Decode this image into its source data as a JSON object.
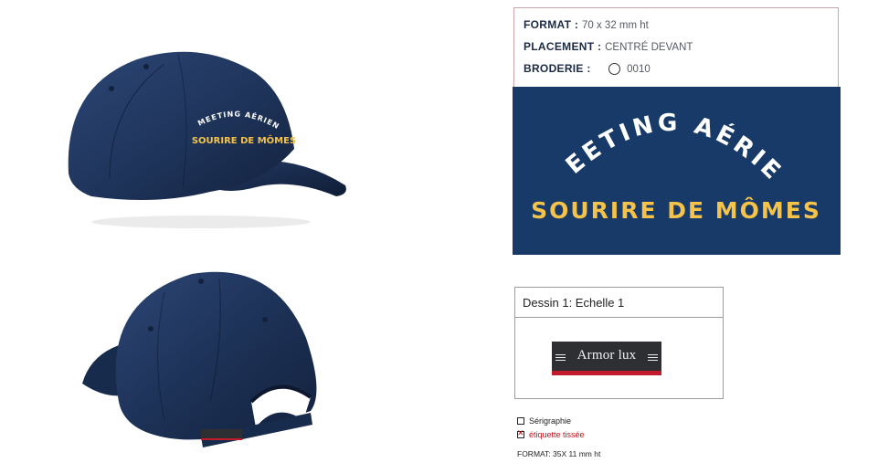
{
  "spec": {
    "format_label": "FORMAT :",
    "format_value": "70 x 32 mm ht",
    "placement_label": "PLACEMENT :",
    "placement_value": "CENTRÉ DEVANT",
    "embroidery_label": "BRODERIE :",
    "embroidery_value": "0010"
  },
  "design": {
    "arc_text": "MEETING AÉRIEN",
    "main_text": "SOURIRE DE MÔMES",
    "background_color": "#173a68",
    "arc_color": "#ffffff",
    "main_color": "#f5c34a"
  },
  "drawing": {
    "title": "Dessin 1: Echelle 1",
    "brand": "Armor lux"
  },
  "options": [
    {
      "label": "Sérigraphie",
      "checked": false,
      "color": "#222222"
    },
    {
      "label": "étiquette tissée",
      "checked": true,
      "color": "#c0141c"
    }
  ],
  "label_format": "FORMAT: 35X 11 mm ht",
  "cap_colors": {
    "navy": "#1d3257",
    "navy_dark": "#13213d",
    "navy_light": "#2c4675"
  }
}
